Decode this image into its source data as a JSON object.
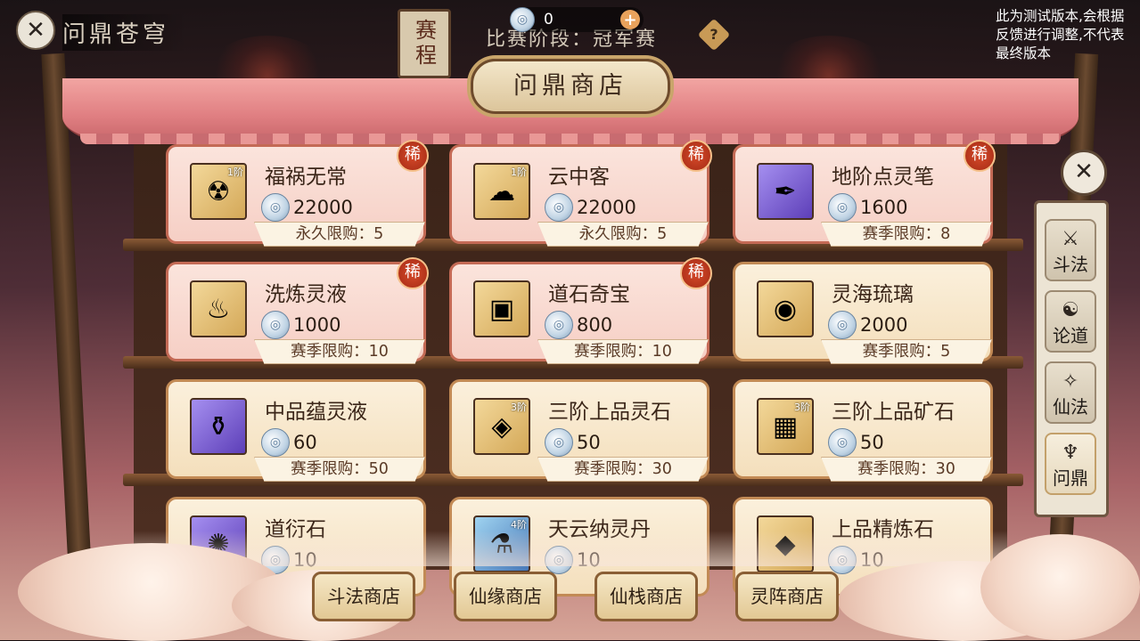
{
  "top_bar": {
    "back_icon": "close-x-icon",
    "title": "问鼎苍穹",
    "schedule_button": "赛程",
    "currency": {
      "icon": "spirit-coin-icon",
      "value": "0",
      "add_icon": "plus-icon"
    },
    "stage_text": "比赛阶段：冠军赛",
    "help_icon": "question-icon",
    "notice": "此为测试版本,会根据反馈进行调整,不代表最终版本"
  },
  "shop": {
    "title": "问鼎商店",
    "rare_label": "稀",
    "items": [
      {
        "name": "福祸无常",
        "price": "22000",
        "limit": "永久限购：5",
        "rare": true,
        "tier": "1阶",
        "icon": "talisman-icon",
        "color": "gold"
      },
      {
        "name": "云中客",
        "price": "22000",
        "limit": "永久限购：5",
        "rare": true,
        "tier": "1阶",
        "icon": "cloud-guest-icon",
        "color": "gold"
      },
      {
        "name": "地阶点灵笔",
        "price": "1600",
        "limit": "赛季限购：8",
        "rare": true,
        "tier": "",
        "icon": "brush-icon",
        "color": "purple"
      },
      {
        "name": "洗炼灵液",
        "price": "1000",
        "limit": "赛季限购：10",
        "rare": true,
        "tier": "",
        "icon": "gourd-icon",
        "color": "gold"
      },
      {
        "name": "道石奇宝",
        "price": "800",
        "limit": "赛季限购：10",
        "rare": true,
        "tier": "",
        "icon": "treasure-chest-icon",
        "color": "gold"
      },
      {
        "name": "灵海琉璃",
        "price": "2000",
        "limit": "赛季限购：5",
        "rare": false,
        "tier": "",
        "icon": "pearl-icon",
        "color": "gold"
      },
      {
        "name": "中品蕴灵液",
        "price": "60",
        "limit": "赛季限购：50",
        "rare": false,
        "tier": "",
        "icon": "vase-icon",
        "color": "purple"
      },
      {
        "name": "三阶上品灵石",
        "price": "50",
        "limit": "赛季限购：30",
        "rare": false,
        "tier": "3阶",
        "icon": "spirit-stone-chest-icon",
        "color": "gold"
      },
      {
        "name": "三阶上品矿石",
        "price": "50",
        "limit": "赛季限购：30",
        "rare": false,
        "tier": "3阶",
        "icon": "ore-crate-icon",
        "color": "gold"
      },
      {
        "name": "道衍石",
        "price": "10",
        "limit": "",
        "rare": false,
        "tier": "",
        "icon": "dao-stone-icon",
        "color": "purple"
      },
      {
        "name": "天云纳灵丹",
        "price": "10",
        "limit": "",
        "rare": false,
        "tier": "4阶",
        "icon": "pill-bottle-icon",
        "color": "blue"
      },
      {
        "name": "上品精炼石",
        "price": "10",
        "limit": "",
        "rare": false,
        "tier": "",
        "icon": "blue-gem-icon",
        "color": "gold"
      }
    ]
  },
  "side_tabs": {
    "close_icon": "close-x-icon",
    "tabs": [
      {
        "label": "斗法",
        "icon": "duel-icon",
        "active": false
      },
      {
        "label": "论道",
        "icon": "debate-icon",
        "active": false
      },
      {
        "label": "仙法",
        "icon": "immortal-art-icon",
        "active": false
      },
      {
        "label": "问鼎",
        "icon": "wending-icon",
        "active": true
      }
    ]
  },
  "bottom_buttons": [
    "斗法商店",
    "仙缘商店",
    "仙栈商店",
    "灵阵商店"
  ],
  "colors": {
    "rare_card": "#f6cfc5",
    "normal_card": "#f4dfbc",
    "rare_badge": "#c13b1f",
    "frame_wood": "#6a4a30"
  }
}
